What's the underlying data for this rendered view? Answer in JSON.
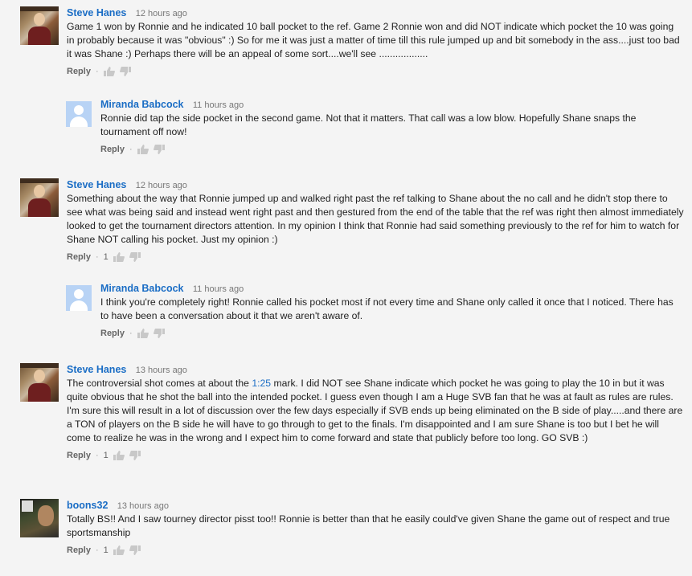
{
  "comments": [
    {
      "author": "Steve Hanes",
      "time": "12 hours ago",
      "text": "Game 1 won by Ronnie and he indicated 10 ball pocket to the ref.  Game 2 Ronnie won and did NOT indicate which pocket the 10 was going in probably because it was \"obvious\" :)  So for me it was just a matter of time till this rule jumped up and bit somebody in the ass....just too bad it was Shane :)  Perhaps there will be an appeal of some sort....we'll see ..................",
      "reply_label": "Reply",
      "likes": ""
    },
    {
      "author": "Miranda Babcock",
      "time": "11 hours ago",
      "text": "Ronnie did tap the side pocket in the second game. Not that it matters. That call was a low blow. Hopefully Shane snaps the tournament off now!",
      "reply_label": "Reply",
      "likes": ""
    },
    {
      "author": "Steve Hanes",
      "time": "12 hours ago",
      "text": "Something about the way that Ronnie jumped up and walked right past the ref talking to Shane about the no call and he didn't stop there to see what was being said and instead went right past and then gestured from the end of the table that the ref was right then almost immediately looked to get the tournament directors attention.  In my opinion I think that Ronnie had said something previously to the ref for him to watch for Shane NOT calling his pocket.  Just my opinion :)",
      "reply_label": "Reply",
      "likes": "1"
    },
    {
      "author": "Miranda Babcock",
      "time": "11 hours ago",
      "text": "I think you're completely right! Ronnie called his pocket most if not every time and Shane only called it once that I noticed. There has to have been a conversation about it that we aren't aware of.",
      "reply_label": "Reply",
      "likes": ""
    },
    {
      "author": "Steve Hanes",
      "time": "13 hours ago",
      "text_before": "The controversial shot comes at about the ",
      "timestamp_link": "1:25",
      "text_after": " mark.  I did NOT see Shane indicate which pocket he was going to play the 10 in but it was quite obvious that he shot the ball into the intended pocket.  I guess even though I am a Huge SVB fan that he was at fault as rules are rules.  I'm sure this will result in a lot of discussion over the few days especially if SVB ends up being eliminated on the B side of play.....and there are a TON of players on the B side he will have to go through to get to the finals.  I'm disappointed and I am sure Shane is too but I bet he will come to realize he was in the wrong and I expect him to come forward and state that publicly before too long.  GO SVB :)",
      "reply_label": "Reply",
      "likes": "1"
    },
    {
      "author": "boons32",
      "time": "13 hours ago",
      "text": "Totally BS!! And I saw tourney director pisst too!! Ronnie is better than that he easily could've given Shane the game out of respect and true sportsmanship",
      "reply_label": "Reply",
      "likes": "1"
    }
  ],
  "icons": {
    "like": "thumbs-up-icon",
    "dislike": "thumbs-down-icon"
  },
  "colors": {
    "author": "#1a6dc5",
    "background": "#f4f4f4",
    "meta": "#777777"
  }
}
